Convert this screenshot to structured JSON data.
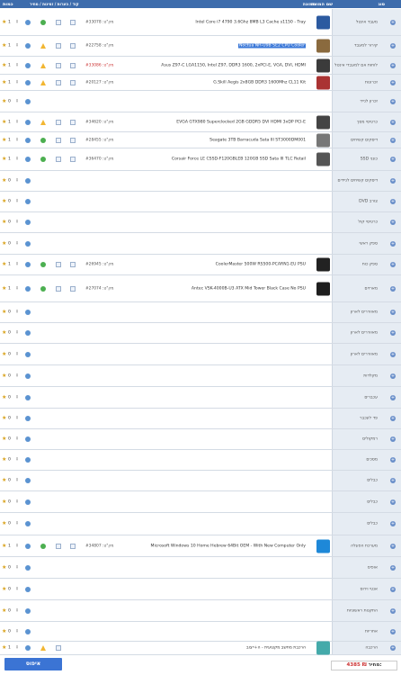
{
  "header": {
    "col_category": "סוג",
    "col_name": "שם המוצר",
    "col_image": "תמונה",
    "col_misc": "קוד / הערות / זמינות / מחיר",
    "col_qty": "כמות"
  },
  "rows": [
    {
      "category": "מעבד אינטל",
      "name": "Intel Core i7 4790 3.6Ghz 8MB L3 Cache s1150 - Tray",
      "code": "מק\"ט: #33078",
      "status": "ok",
      "qty": "1",
      "thumb": "#2c5aa0"
    },
    {
      "category": "קירור למעבד",
      "name": "Noctua NH-U9B SE2 CPU Cooler",
      "code": "מק\"ט: #22758",
      "status": "warn",
      "qty": "1",
      "highlight": true,
      "thumb": "#8a6a3e"
    },
    {
      "category": "לוחות אם למעבדי אינטל",
      "name": "Asus Z97-C LGA1150, Intel Z97, DDR3 1600, 2xPCI-E, VGA, DVI, HDMI",
      "code": "מק\"ט: #33086",
      "code_red": true,
      "status": "warn",
      "qty": "1",
      "thumb": "#3b3b3b"
    },
    {
      "category": "זכרונות",
      "name": "G.Skill Aegis 2x8GB DDR3 1600Mhz CL11 Kit",
      "code": "מק\"ט: #20127",
      "status": "warn",
      "qty": "1",
      "thumb": "#a33"
    },
    {
      "category": "זכרון לנייד",
      "qty": "0"
    },
    {
      "category": "כרטיסי מסך",
      "name": "EVGA GTX980 Superclocked 2GB GDDR5 DVI HDMI 3xDP PCI-E",
      "code": "מק\"ט: #34620",
      "status": "warn",
      "qty": "1",
      "thumb": "#444"
    },
    {
      "category": "דיסקים קשיחים",
      "name": "Seagate 3TB Barracuda Sata III ST3000DM001",
      "code": "מק\"ט: #28455",
      "status": "ok",
      "qty": "1",
      "thumb": "#777"
    },
    {
      "category": "כונני SSD",
      "name": "Corsair Force LE CSSD-F120GBLEB 120GB SSD Sata III TLC Retail",
      "code": "מק\"ט: #36470",
      "status": "ok",
      "qty": "1",
      "thumb": "#555"
    },
    {
      "category": "דיסקים קשיחים לניידים",
      "qty": "0"
    },
    {
      "category": "צורב DVD",
      "qty": "0"
    },
    {
      "category": "כרטיסי קול",
      "qty": "0"
    },
    {
      "category": "ספק ראשי",
      "qty": "0"
    },
    {
      "category": "ספק כוח",
      "name": "CoolerMaster 500W RS500-PCARN1-EU PSU",
      "code": "מק\"ט: #26945",
      "status": "ok",
      "qty": "1",
      "thumb": "#222"
    },
    {
      "category": "מארזים",
      "name": "Antec VSK-4000B-U3 ATX Mid Tower Black Case No PSU",
      "code": "מק\"ט: #27074",
      "status": "ok",
      "qty": "1",
      "thumb": "#1e1e1e"
    },
    {
      "category": "מאווררים לארון",
      "qty": "0"
    },
    {
      "category": "מאווררים לארון",
      "qty": "0"
    },
    {
      "category": "מאווררים לארון",
      "qty": "0"
    },
    {
      "category": "מקלדות",
      "qty": "0"
    },
    {
      "category": "עכברים",
      "qty": "0"
    },
    {
      "category": "פד לעכבר",
      "qty": "0"
    },
    {
      "category": "רמקולים",
      "qty": "0"
    },
    {
      "category": "מסכים",
      "qty": "0"
    },
    {
      "category": "כבלים",
      "qty": "0"
    },
    {
      "category": "כבלים",
      "qty": "0"
    },
    {
      "category": "כבלים",
      "qty": "0"
    },
    {
      "category": "מערכת הפעלה",
      "name": "Microsoft Windows 10 Home Hebrew 64Bit OEM - With New Computer Only",
      "code": "מק\"ט: #34807",
      "status": "ok",
      "qty": "1",
      "thumb": "#1e88d8"
    },
    {
      "category": "אופיס",
      "qty": "0"
    },
    {
      "category": "אנטי וירוס",
      "qty": "0"
    },
    {
      "category": "התקנות ראשוניות",
      "qty": "0"
    },
    {
      "category": "אחריות",
      "qty": "0"
    },
    {
      "category": "הרכבה",
      "name": "הרכבת מחשב מקצועית - ה+ייצוב",
      "status": "warn",
      "qty": "1",
      "thumb": "#4aa",
      "small": true
    }
  ],
  "footer": {
    "price_label": "מחיר:",
    "price_value": "4385 ₪",
    "buy_label": "איפוס"
  }
}
